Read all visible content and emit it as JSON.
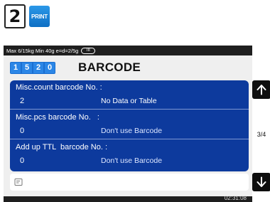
{
  "step": {
    "number": "2",
    "key_label": "PRINT"
  },
  "status_bar": {
    "text": "Max 6/15kg Min 40g e=d=2/5g",
    "battery_label": "III"
  },
  "header": {
    "digits": [
      "1",
      "5",
      "2",
      "0"
    ],
    "title": "BARCODE"
  },
  "fields": [
    {
      "label": "Misc.count barcode No. :",
      "value": "2",
      "description": "No Data or Table"
    },
    {
      "label": "Misc.pcs barcode No.   :",
      "value": "0",
      "description": "Don't use Barcode"
    },
    {
      "label": "Add up TTL  barcode No. :",
      "value": "0",
      "description": "Don't use Barcode"
    }
  ],
  "input": {
    "value": "",
    "icon": "edit-icon"
  },
  "pager": {
    "indicator": "3/4",
    "up_icon": "arrow-up-icon",
    "down_icon": "arrow-down-icon"
  },
  "clock": "02:31:08",
  "colors": {
    "panel": "#0d3a9d",
    "digit": "#2b86e6",
    "status_bar": "#1f1f1f",
    "key": "#0e6fc4"
  }
}
